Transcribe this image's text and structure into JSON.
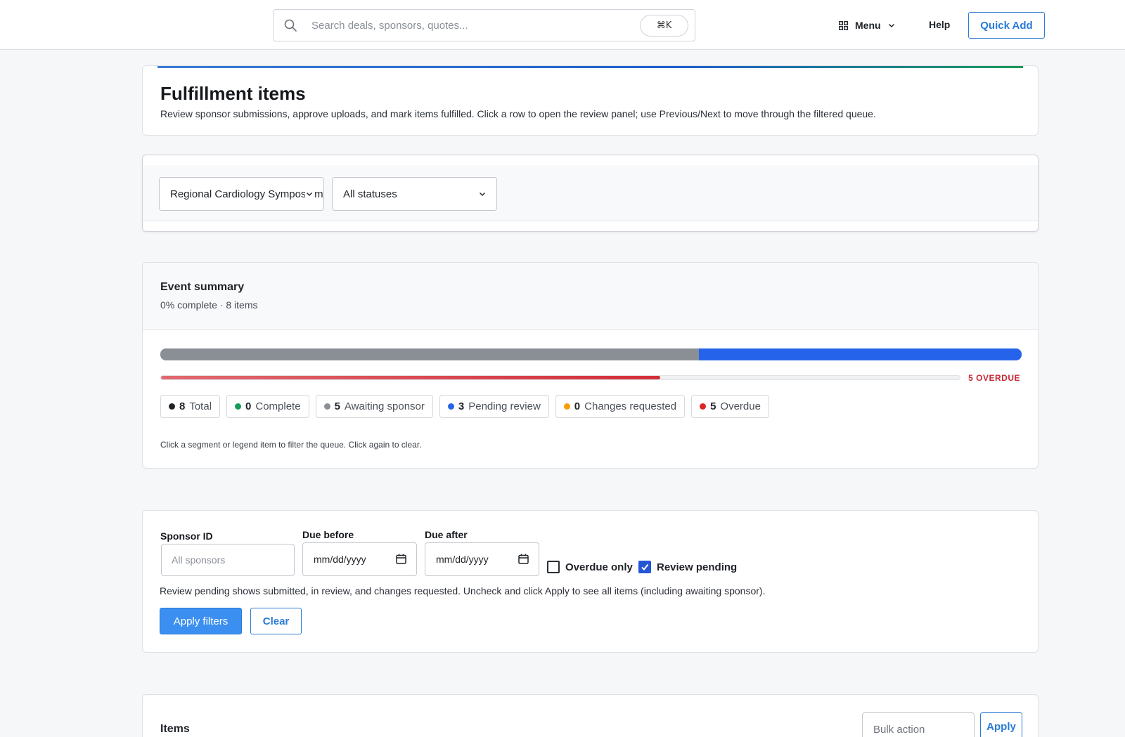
{
  "topbar": {
    "search_placeholder": "Search deals, sponsors, quotes...",
    "shortcut": "⌘K",
    "menu_label": "Menu",
    "help_label": "Help",
    "quick_add_label": "Quick Add"
  },
  "header": {
    "title": "Fulfillment items",
    "description": "Review sponsor submissions, approve uploads, and mark items fulfilled. Click a row to open the review panel; use Previous/Next to move through the filtered queue."
  },
  "event_filter": {
    "event_selected": "Regional Cardiology Symposium",
    "status_selected": "All statuses"
  },
  "summary": {
    "title": "Event summary",
    "subtitle": "0% complete · 8 items",
    "segments": [
      {
        "name": "awaiting-sponsor",
        "count": 5,
        "color": "#8a8f95"
      },
      {
        "name": "pending-review",
        "count": 3,
        "color": "#2563eb"
      }
    ],
    "overdue_fraction": 0.625,
    "overdue_label": "5 OVERDUE",
    "legend": [
      {
        "count": "8",
        "label": "Total",
        "color": "#1f2328"
      },
      {
        "count": "0",
        "label": "Complete",
        "color": "#1a9a5a"
      },
      {
        "count": "5",
        "label": "Awaiting sponsor",
        "color": "#8a8f95"
      },
      {
        "count": "3",
        "label": "Pending review",
        "color": "#2563eb"
      },
      {
        "count": "0",
        "label": "Changes requested",
        "color": "#f59e0b"
      },
      {
        "count": "5",
        "label": "Overdue",
        "color": "#dc2626"
      }
    ],
    "hint": "Click a segment or legend item to filter the queue. Click again to clear."
  },
  "filters": {
    "sponsor_label": "Sponsor ID",
    "sponsor_placeholder": "All sponsors",
    "due_before_label": "Due before",
    "due_before_value": "mm/dd/yyyy",
    "due_after_label": "Due after",
    "due_after_value": "mm/dd/yyyy",
    "overdue_only_label": "Overdue only",
    "overdue_only_checked": false,
    "review_pending_label": "Review pending",
    "review_pending_checked": true,
    "note": "Review pending shows submitted, in review, and changes requested. Uncheck and click Apply to see all items (including awaiting sponsor).",
    "apply_label": "Apply filters",
    "clear_label": "Clear"
  },
  "items": {
    "title": "Items",
    "bulk_placeholder": "Bulk action",
    "bulk_apply_label": "Apply"
  }
}
